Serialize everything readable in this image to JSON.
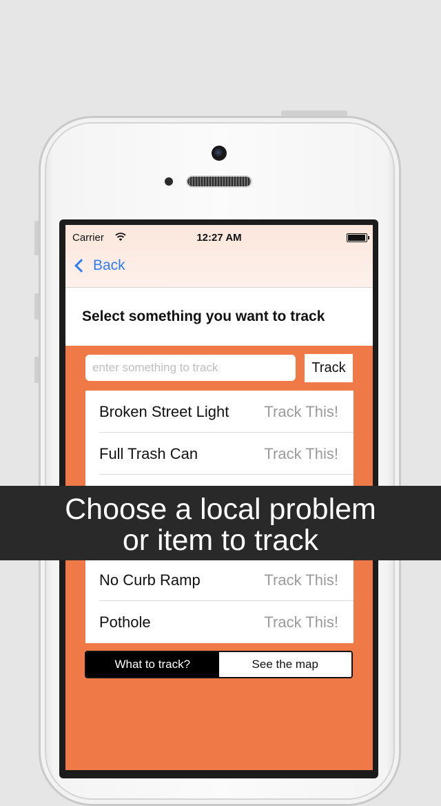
{
  "colors": {
    "background": "#e6e6e6",
    "screen_accent": "#ef7a48",
    "nav_tint": "#fbe6dc",
    "link_blue": "#2e7cf6",
    "banner": "#292929"
  },
  "status_bar": {
    "carrier": "Carrier",
    "time": "12:27 AM",
    "battery_level": 0.95
  },
  "nav": {
    "back_label": "Back"
  },
  "page": {
    "title": "Select something you want to track"
  },
  "search": {
    "placeholder": "enter something to track",
    "value": "",
    "button_label": "Track"
  },
  "items": [
    {
      "label": "Broken Street Light",
      "action": "Track This!"
    },
    {
      "label": "Full Trash Can",
      "action": "Track This!"
    },
    {
      "label": "",
      "action": ""
    },
    {
      "label": "",
      "action": ""
    },
    {
      "label": "No Curb Ramp",
      "action": "Track This!"
    },
    {
      "label": "Pothole",
      "action": "Track This!"
    }
  ],
  "segments": {
    "options": [
      "What to track?",
      "See the map"
    ],
    "selected": "What to track?"
  },
  "banner": {
    "line1": "Choose a local problem",
    "line2": "or item to track"
  }
}
